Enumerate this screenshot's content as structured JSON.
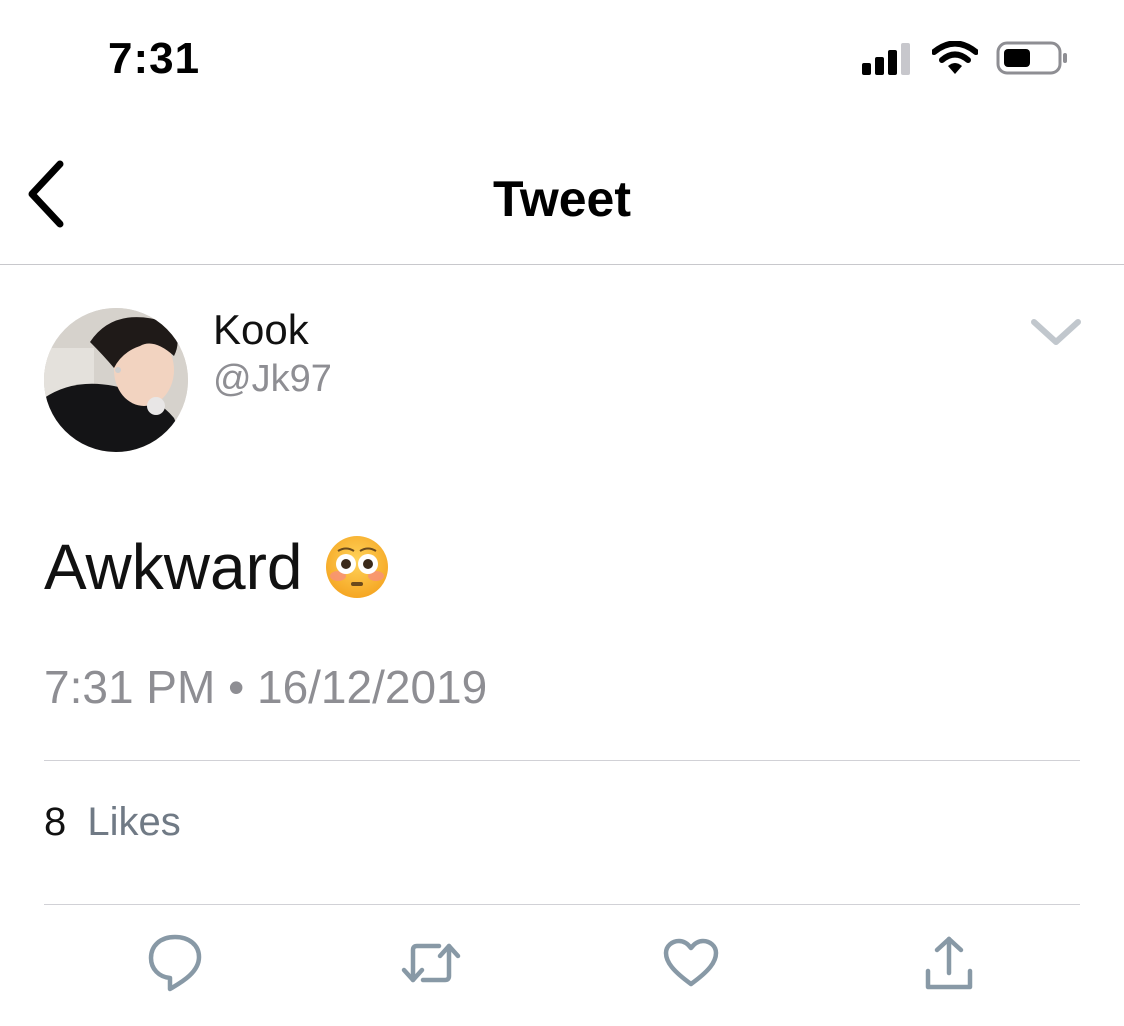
{
  "status_bar": {
    "time": "7:31",
    "signal_icon": "cellular-signal-icon",
    "wifi_icon": "wifi-icon",
    "battery_icon": "battery-icon"
  },
  "nav": {
    "back_icon": "chevron-left-icon",
    "title": "Tweet"
  },
  "tweet": {
    "author_name": "Kook",
    "author_handle": "@Jk97",
    "avatar_icon": "user-avatar",
    "more_icon": "chevron-down-icon",
    "text": "Awkward",
    "emoji": "😳",
    "time": "7:31 PM",
    "separator": "•",
    "date": "16/12/2019",
    "likes_count": "8",
    "likes_label": "Likes"
  },
  "actions": [
    {
      "name": "reply",
      "icon": "reply-icon"
    },
    {
      "name": "retweet",
      "icon": "retweet-icon"
    },
    {
      "name": "like",
      "icon": "heart-icon"
    },
    {
      "name": "share",
      "icon": "share-icon"
    }
  ],
  "colors": {
    "secondary_text": "#8e8e93",
    "action_icon": "#8899a6",
    "divider": "#d1d1d6"
  }
}
